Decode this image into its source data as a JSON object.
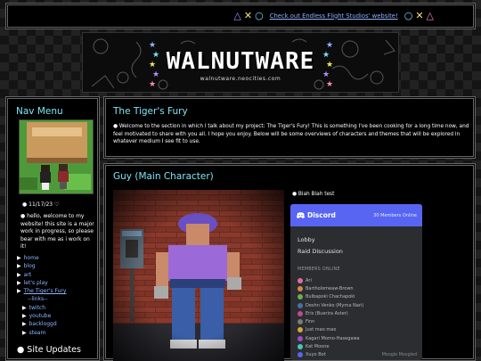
{
  "top_bar": {
    "link_text": "Check out Endless Flight Studios' website!",
    "shapes_left": [
      "triangle-icon",
      "x-icon",
      "circle-icon"
    ],
    "shapes_right": [
      "circle-icon",
      "x-icon",
      "triangle-icon"
    ]
  },
  "banner": {
    "logo": "WALNUTWARE",
    "subtitle": "walnutware.neocities.com"
  },
  "nav": {
    "title": "Nav Menu",
    "date": "● 11/17/23 ♡",
    "hello": "● hello, welcome to my website! this site is a major work in progress, so please bear with me as i work on it!",
    "links": [
      {
        "label": "home"
      },
      {
        "label": "blog"
      },
      {
        "label": "art"
      },
      {
        "label": "let's play"
      },
      {
        "label": "The Tiger's Fury"
      }
    ],
    "links_header": "--links--",
    "external_links": [
      {
        "label": "twitch"
      },
      {
        "label": "youtube"
      },
      {
        "label": "backloggd"
      },
      {
        "label": "steam"
      }
    ],
    "site_updates": "● Site Updates"
  },
  "intro": {
    "title": "The Tiger's Fury",
    "text": "● Welcome to the section in which I talk about my project: The Tiger's Fury! This is something I've been cooking for a long time now, and feel motivated to share with you all. I hope you enjoy. Below will be some overviews of characters and themes that will be explored in whatever medium I see fit to use."
  },
  "guy": {
    "title": "Guy (Main Character)",
    "bullet": "● Blah Blah test"
  },
  "discord": {
    "name": "Discord",
    "online": "30 Members Online",
    "channels": [
      "Lobby",
      "Raid Discussion"
    ],
    "members_header": "MEMBERS ONLINE",
    "members": [
      {
        "name": "Ari",
        "color": "#e06c9f"
      },
      {
        "name": "Bartholomeaw-Brown",
        "color": "#d28a4a"
      },
      {
        "name": "Bulbapoki Chachapoki",
        "color": "#6ab04c"
      },
      {
        "name": "Deshn Venko (Myrna Nari)",
        "color": "#4a6fa5"
      },
      {
        "name": "Eris (Buerira Aster)",
        "color": "#c44a8a"
      },
      {
        "name": "Finn",
        "color": "#7a7a7a"
      },
      {
        "name": "Just mao mao",
        "color": "#d9a441"
      },
      {
        "name": "Kagari Momo-Hasegawa",
        "color": "#a04ac4"
      },
      {
        "name": "Kat Moone",
        "color": "#4ac4b5"
      },
      {
        "name": "Xuyo Bot",
        "color": "#5865f2"
      }
    ],
    "footer": "Moogle Moogled"
  },
  "colors": {
    "accent_heading": "#7ee3f2",
    "link": "#8fb4ff",
    "discord_blurple": "#5865f2",
    "panel_bg": "#000000"
  }
}
